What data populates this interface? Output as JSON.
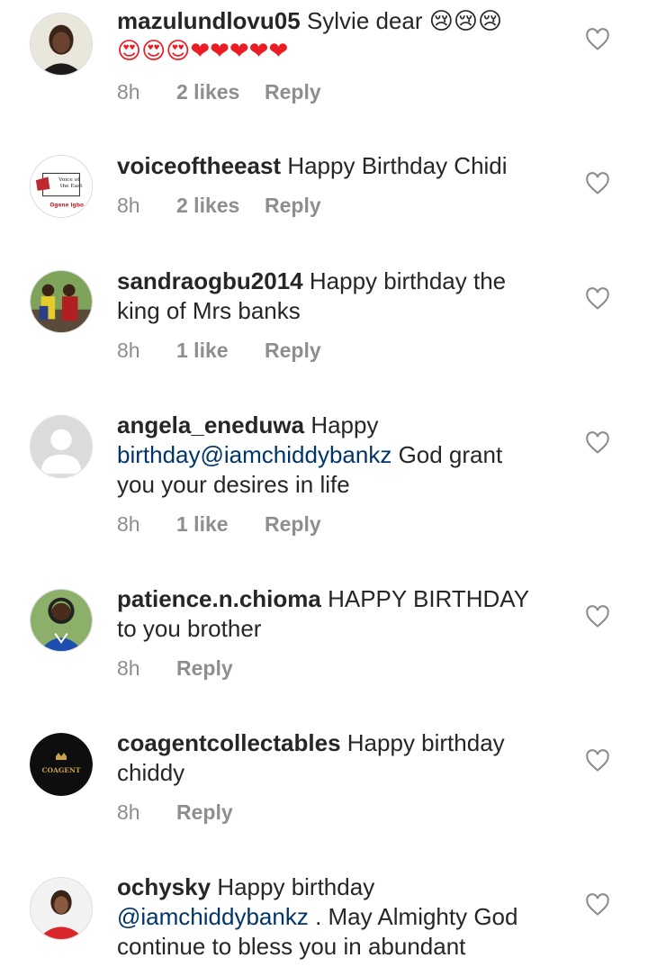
{
  "comments": [
    {
      "username": "mazulundlovu05",
      "text": "Sylvie dear 😢😢😢",
      "text2": "😍😍😍❤❤❤❤❤",
      "time": "8h",
      "likes": "2 likes",
      "reply": "Reply",
      "avatar_icon": "woman-portrait"
    },
    {
      "username": "voiceoftheeast",
      "text": "Happy Birthday Chidi",
      "time": "8h",
      "likes": "2 likes",
      "reply": "Reply",
      "avatar_logo_line1": "Voice of",
      "avatar_logo_line2": "the East",
      "avatar_logo_line3": "Ogene Igbo",
      "avatar_icon": "voice-of-the-east-logo"
    },
    {
      "username": "sandraogbu2014",
      "text_line1": "Happy birthday the",
      "text_line2": "king of Mrs banks",
      "time": "8h",
      "likes": "1 like",
      "reply": "Reply",
      "avatar_icon": "group-photo"
    },
    {
      "username": "angela_eneduwa",
      "text_line1": "Happy",
      "mention_line2": "birthday@iamchiddybankz",
      "text_line2_rest": "God grant",
      "text_line3": "you your desires in life",
      "time": "8h",
      "likes": "1 like",
      "reply": "Reply",
      "avatar_icon": "default-user-silhouette"
    },
    {
      "username": "patience.n.chioma",
      "text_line1": "HAPPY BIRTHDAY",
      "text_line2": "to you brother",
      "time": "8h",
      "reply": "Reply",
      "avatar_icon": "woman-outdoor-portrait"
    },
    {
      "username": "coagentcollectables",
      "text_line1": "Happy birthday",
      "text_line2": "chiddy",
      "time": "8h",
      "reply": "Reply",
      "avatar_brand": "COAGENT",
      "avatar_icon": "coagent-logo"
    },
    {
      "username": "ochysky",
      "text_line1": "Happy birthday",
      "mention_line2": "@iamchiddybankz",
      "text_line2_rest": ". May Almighty God",
      "text_line3": "continue to bless you in abundant",
      "avatar_icon": "woman-red-dress-portrait"
    }
  ],
  "like_icon": "heart-outline-icon",
  "colors": {
    "text": "#262626",
    "meta": "#8e8e8e",
    "mention": "#003569",
    "heart": "#ed1c24"
  }
}
